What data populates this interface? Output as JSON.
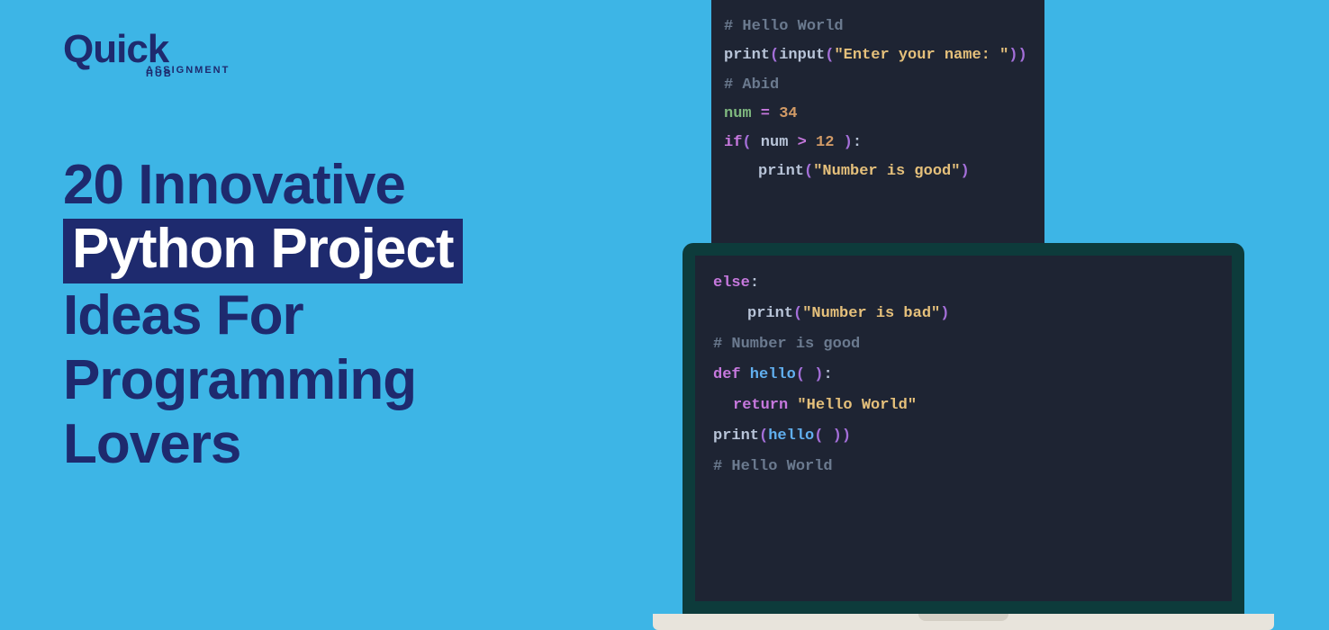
{
  "logo": {
    "main": "Quick",
    "sub1": "ASSIGNMENT",
    "sub2": "HUB"
  },
  "headline": {
    "line1": "20 Innovative",
    "highlight": "Python Project",
    "line3": "Ideas For",
    "line4": "Programming",
    "line5": "Lovers"
  },
  "code_back": {
    "l1_comment": "# Hello World",
    "l2_func": "print",
    "l2_func2": "input",
    "l2_str": "\"Enter your name: \"",
    "l3_comment": "# Abid",
    "l4_var": "num",
    "l4_eq": " = ",
    "l4_num": "34",
    "l5_if": "if",
    "l5_var": " num ",
    "l5_op": ">",
    "l5_num": " 12 ",
    "l6_func": "print",
    "l6_str": "\"Number is good\""
  },
  "code_front": {
    "l1_else": "else",
    "l2_func": "print",
    "l2_str": "\"Number is bad\"",
    "l3_comment": "# Number is good",
    "l4_def": "def",
    "l4_name": " hello",
    "l5_ret": "return",
    "l5_str": " \"Hello World\"",
    "l6_func": "print",
    "l6_call": "hello",
    "l7_comment": "# Hello World"
  }
}
